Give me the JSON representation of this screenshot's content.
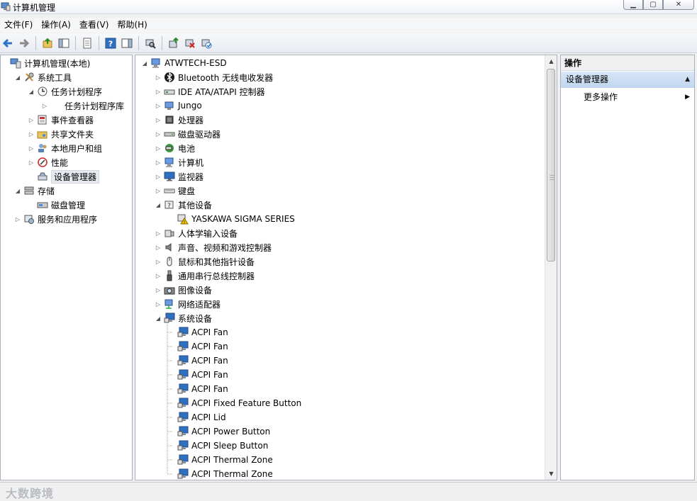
{
  "window": {
    "title": "计算机管理"
  },
  "menu": [
    "文件(F)",
    "操作(A)",
    "查看(V)",
    "帮助(H)"
  ],
  "left_tree": [
    {
      "label": "计算机管理(本地)",
      "depth": 0,
      "expander": "",
      "icon": "computer-management-icon"
    },
    {
      "label": "系统工具",
      "depth": 1,
      "expander": "expanded",
      "icon": "tools-icon"
    },
    {
      "label": "任务计划程序",
      "depth": 2,
      "expander": "expanded",
      "icon": "clock-icon"
    },
    {
      "label": "任务计划程序库",
      "depth": 3,
      "expander": "collapsed",
      "icon": ""
    },
    {
      "label": "事件查看器",
      "depth": 2,
      "expander": "collapsed",
      "icon": "event-viewer-icon"
    },
    {
      "label": "共享文件夹",
      "depth": 2,
      "expander": "collapsed",
      "icon": "shared-folder-icon"
    },
    {
      "label": "本地用户和组",
      "depth": 2,
      "expander": "collapsed",
      "icon": "users-icon"
    },
    {
      "label": "性能",
      "depth": 2,
      "expander": "collapsed",
      "icon": "performance-icon"
    },
    {
      "label": "设备管理器",
      "depth": 2,
      "expander": "",
      "icon": "device-manager-icon",
      "selected": true
    },
    {
      "label": "存储",
      "depth": 1,
      "expander": "expanded",
      "icon": "storage-icon"
    },
    {
      "label": "磁盘管理",
      "depth": 2,
      "expander": "",
      "icon": "disk-management-icon"
    },
    {
      "label": "服务和应用程序",
      "depth": 1,
      "expander": "collapsed",
      "icon": "services-icon"
    }
  ],
  "device_tree": [
    {
      "label": "ATWTECH-ESD",
      "depth": 0,
      "expander": "expanded",
      "icon": "computer-icon"
    },
    {
      "label": "Bluetooth 无线电收发器",
      "depth": 1,
      "expander": "collapsed",
      "icon": "bluetooth-icon"
    },
    {
      "label": "IDE ATA/ATAPI 控制器",
      "depth": 1,
      "expander": "collapsed",
      "icon": "ide-controller-icon"
    },
    {
      "label": "Jungo",
      "depth": 1,
      "expander": "collapsed",
      "icon": "device-icon"
    },
    {
      "label": "处理器",
      "depth": 1,
      "expander": "collapsed",
      "icon": "processor-icon"
    },
    {
      "label": "磁盘驱动器",
      "depth": 1,
      "expander": "collapsed",
      "icon": "disk-drive-icon"
    },
    {
      "label": "电池",
      "depth": 1,
      "expander": "collapsed",
      "icon": "battery-icon"
    },
    {
      "label": "计算机",
      "depth": 1,
      "expander": "collapsed",
      "icon": "computer-icon"
    },
    {
      "label": "监视器",
      "depth": 1,
      "expander": "collapsed",
      "icon": "monitor-icon"
    },
    {
      "label": "键盘",
      "depth": 1,
      "expander": "collapsed",
      "icon": "keyboard-icon"
    },
    {
      "label": "其他设备",
      "depth": 1,
      "expander": "expanded",
      "icon": "unknown-device-icon"
    },
    {
      "label": "YASKAWA SIGMA SERIES",
      "depth": 2,
      "expander": "",
      "icon": "warning-device-icon"
    },
    {
      "label": "人体学输入设备",
      "depth": 1,
      "expander": "collapsed",
      "icon": "hid-icon"
    },
    {
      "label": "声音、视频和游戏控制器",
      "depth": 1,
      "expander": "collapsed",
      "icon": "sound-icon"
    },
    {
      "label": "鼠标和其他指针设备",
      "depth": 1,
      "expander": "collapsed",
      "icon": "mouse-icon"
    },
    {
      "label": "通用串行总线控制器",
      "depth": 1,
      "expander": "collapsed",
      "icon": "usb-icon"
    },
    {
      "label": "图像设备",
      "depth": 1,
      "expander": "collapsed",
      "icon": "camera-icon"
    },
    {
      "label": "网络适配器",
      "depth": 1,
      "expander": "collapsed",
      "icon": "network-icon"
    },
    {
      "label": "系统设备",
      "depth": 1,
      "expander": "expanded",
      "icon": "system-device-icon"
    },
    {
      "label": "ACPI Fan",
      "depth": 2,
      "expander": "",
      "icon": "system-device-icon"
    },
    {
      "label": "ACPI Fan",
      "depth": 2,
      "expander": "",
      "icon": "system-device-icon"
    },
    {
      "label": "ACPI Fan",
      "depth": 2,
      "expander": "",
      "icon": "system-device-icon"
    },
    {
      "label": "ACPI Fan",
      "depth": 2,
      "expander": "",
      "icon": "system-device-icon"
    },
    {
      "label": "ACPI Fan",
      "depth": 2,
      "expander": "",
      "icon": "system-device-icon"
    },
    {
      "label": "ACPI Fixed Feature Button",
      "depth": 2,
      "expander": "",
      "icon": "system-device-icon"
    },
    {
      "label": "ACPI Lid",
      "depth": 2,
      "expander": "",
      "icon": "system-device-icon"
    },
    {
      "label": "ACPI Power Button",
      "depth": 2,
      "expander": "",
      "icon": "system-device-icon"
    },
    {
      "label": "ACPI Sleep Button",
      "depth": 2,
      "expander": "",
      "icon": "system-device-icon"
    },
    {
      "label": "ACPI Thermal Zone",
      "depth": 2,
      "expander": "",
      "icon": "system-device-icon"
    },
    {
      "label": "ACPI Thermal Zone",
      "depth": 2,
      "expander": "",
      "icon": "system-device-icon"
    }
  ],
  "actions": {
    "header": "操作",
    "section": "设备管理器",
    "more": "更多操作"
  },
  "watermark": "大数跨境",
  "colors": {
    "selection_bg": "#e6e9ef",
    "action_section_bg": "#c8dbf2",
    "pane_border": "#a9b2be"
  }
}
